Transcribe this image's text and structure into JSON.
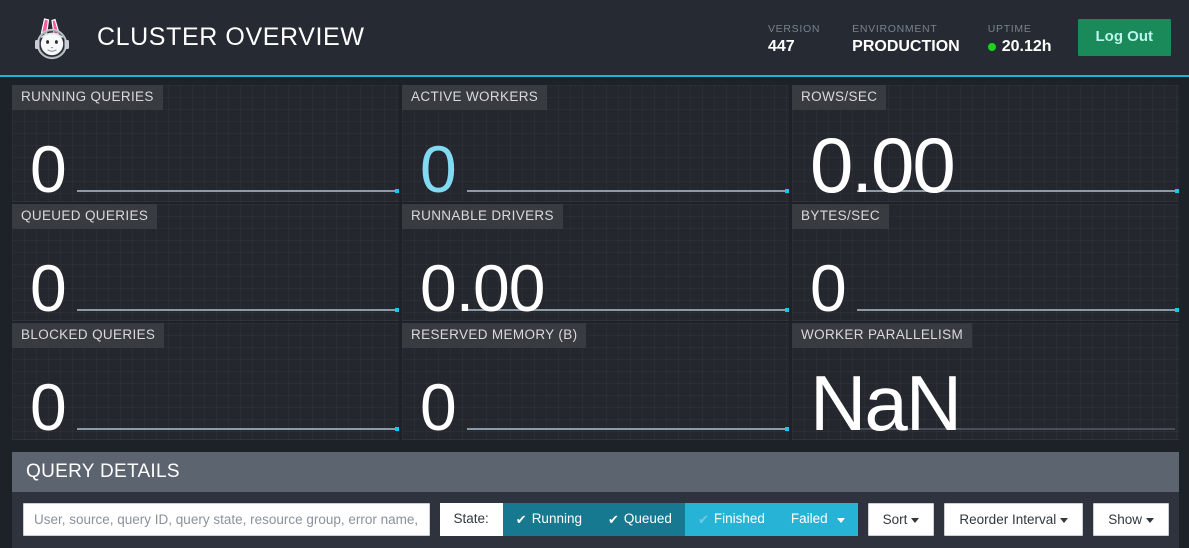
{
  "header": {
    "logo_icon": "trino-bunny-helmet-logo",
    "title": "CLUSTER OVERVIEW",
    "stats": [
      {
        "label": "VERSION",
        "value": "447"
      },
      {
        "label": "ENVIRONMENT",
        "value": "PRODUCTION"
      },
      {
        "label": "UPTIME",
        "value": "20.12h",
        "status_dot_color": "#19d419"
      }
    ],
    "logout_label": "Log Out"
  },
  "cards": {
    "col1": [
      {
        "label": "RUNNING QUERIES",
        "value": "0",
        "size": "normal",
        "accent": false,
        "spark": true,
        "spark_width": 322
      },
      {
        "label": "QUEUED QUERIES",
        "value": "0",
        "size": "normal",
        "accent": false,
        "spark": true,
        "spark_width": 322
      },
      {
        "label": "BLOCKED QUERIES",
        "value": "0",
        "size": "normal",
        "accent": false,
        "spark": true,
        "spark_width": 322
      }
    ],
    "col2": [
      {
        "label": "ACTIVE WORKERS",
        "value": "0",
        "size": "normal",
        "accent": true,
        "spark": true,
        "spark_width": 322
      },
      {
        "label": "RUNNABLE DRIVERS",
        "value": "0.00",
        "size": "normal",
        "accent": false,
        "spark": true,
        "spark_width": 322
      },
      {
        "label": "RESERVED MEMORY (B)",
        "value": "0",
        "size": "normal",
        "accent": false,
        "spark": true,
        "spark_width": 322
      }
    ],
    "col3": [
      {
        "label": "ROWS/SEC",
        "value": "0.00",
        "size": "large",
        "accent": false,
        "spark": true,
        "spark_width": 322
      },
      {
        "label": "BYTES/SEC",
        "value": "0",
        "size": "normal",
        "accent": false,
        "spark": true,
        "spark_width": 322
      },
      {
        "label": "WORKER PARALLELISM",
        "value": "NaN",
        "size": "large",
        "accent": false,
        "spark": false,
        "spark_width": 322
      }
    ]
  },
  "query_details": {
    "heading": "QUERY DETAILS",
    "search_placeholder": "User, source, query ID, query state, resource group, error name, or query text",
    "search_value": "",
    "state_label": "State:",
    "state_buttons": [
      {
        "label": "Running",
        "checked": true,
        "style": "on"
      },
      {
        "label": "Queued",
        "checked": true,
        "style": "on"
      },
      {
        "label": "Finished",
        "checked": true,
        "style": "hover"
      },
      {
        "label": "Failed",
        "checked": false,
        "style": "hover",
        "caret": true
      }
    ],
    "dropdowns": [
      {
        "label": "Sort"
      },
      {
        "label": "Reorder Interval"
      },
      {
        "label": "Show"
      }
    ]
  },
  "colors": {
    "accent_cyan": "#1fb6d4",
    "spark_dot": "#17c9f0",
    "value_accent": "#82d9f2",
    "logout_green": "#1a8a5a",
    "status_green": "#19d419",
    "seg_active": "#16798f",
    "seg_hover": "#27b3d6",
    "panel_header": "#5c646f"
  }
}
